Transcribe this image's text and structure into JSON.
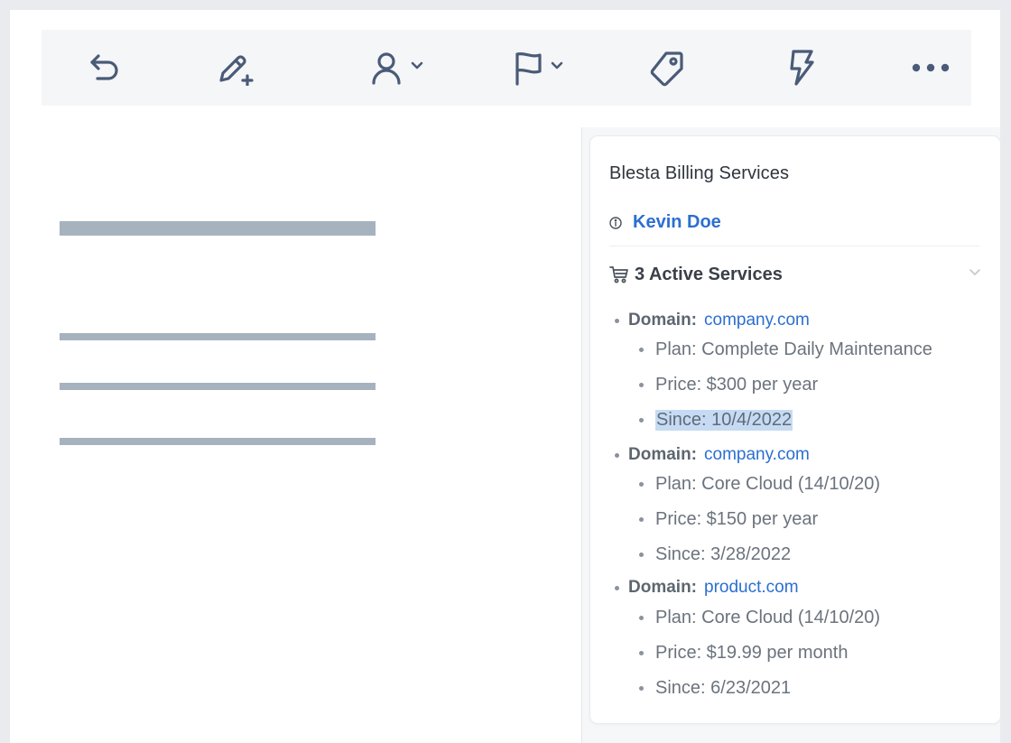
{
  "toolbar": {
    "items": [
      {
        "icon": "undo-icon"
      },
      {
        "icon": "edit-add-icon"
      },
      {
        "icon": "assign-user-icon"
      },
      {
        "icon": "flag-icon"
      },
      {
        "icon": "tag-icon"
      },
      {
        "icon": "lightning-icon"
      },
      {
        "icon": "more-icon"
      }
    ]
  },
  "panel": {
    "title": "Blesta Billing Services",
    "contact_name": "Kevin Doe",
    "services_label": "3 Active Services",
    "services": [
      {
        "domain_label": "Domain:",
        "domain": "company.com",
        "plan": "Plan: Complete Daily Maintenance",
        "price": "Price: $300 per year",
        "since": "Since: 10/4/2022"
      },
      {
        "domain_label": "Domain:",
        "domain": "company.com",
        "plan": "Plan: Core Cloud (14/10/20)",
        "price": "Price: $150 per year",
        "since": "Since: 3/28/2022"
      },
      {
        "domain_label": "Domain:",
        "domain": "product.com",
        "plan": "Plan: Core Cloud (14/10/20)",
        "price": "Price: $19.99 per month",
        "since": "Since: 6/23/2021"
      }
    ]
  },
  "colors": {
    "accent": "#2b6fd1",
    "icon": "#4a5b78",
    "highlight": "#c6dbf3",
    "skeleton": "#a7b2bf"
  }
}
